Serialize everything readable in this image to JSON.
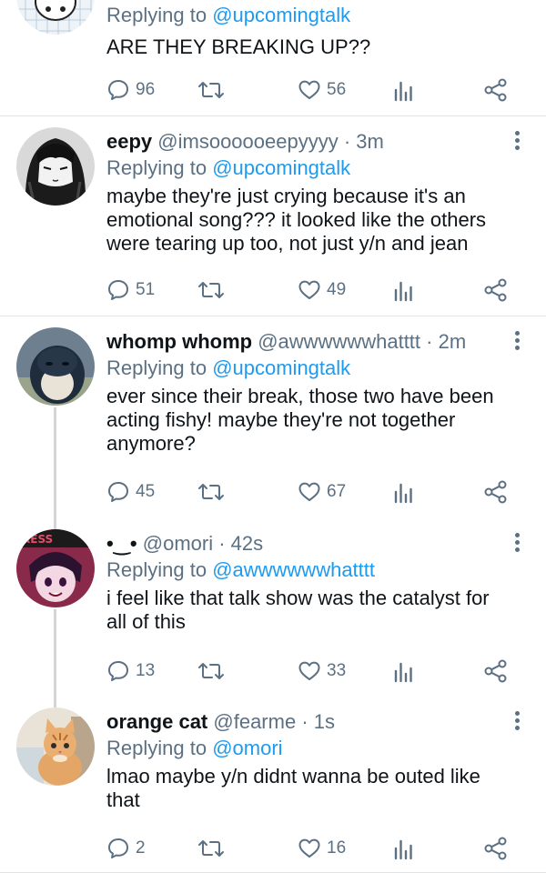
{
  "colors": {
    "accent": "#1d9bf0",
    "secondary_text": "#5b7083",
    "divider": "#e3e3e3"
  },
  "icons": {
    "reply": "comment-icon",
    "retweet": "retweet-icon",
    "like": "heart-icon",
    "analytics": "analytics-icon",
    "share": "share-icon",
    "menu": "more-vertical-icon"
  },
  "tweets": [
    {
      "name": "",
      "handle": "",
      "time": "",
      "replying_label": "Replying to ",
      "replying_to": "@upcomingtalk",
      "text": "ARE THEY BREAKING UP??",
      "replies": "96",
      "likes": "56"
    },
    {
      "name": "eepy",
      "handle": "@imsoooooeepyyyy",
      "time": "· 3m",
      "replying_label": "Replying to ",
      "replying_to": "@upcomingtalk",
      "text": "maybe they're just crying because it's an emotional song??? it looked like the others were tearing up too, not just y/n and jean",
      "replies": "51",
      "likes": "49"
    },
    {
      "name": "whomp whomp",
      "handle": "@awwwwwwhatttt",
      "time": "· 2m",
      "replying_label": "Replying to ",
      "replying_to": "@upcomingtalk",
      "text": "ever since their break, those two have been acting fishy! maybe they're not together anymore?",
      "replies": "45",
      "likes": "67"
    },
    {
      "name": "•‿•",
      "handle": "@omori",
      "time": "· 42s",
      "replying_label": "Replying to ",
      "replying_to": "@awwwwwwhatttt",
      "text": "i feel like that talk show was the catalyst for all of this",
      "replies": "13",
      "likes": "33"
    },
    {
      "name": "orange cat",
      "handle": "@fearme",
      "time": "· 1s",
      "replying_label": "Replying to ",
      "replying_to": "@omori",
      "text": "lmao maybe y/n didnt wanna be outed like that",
      "replies": "2",
      "likes": "16"
    }
  ]
}
